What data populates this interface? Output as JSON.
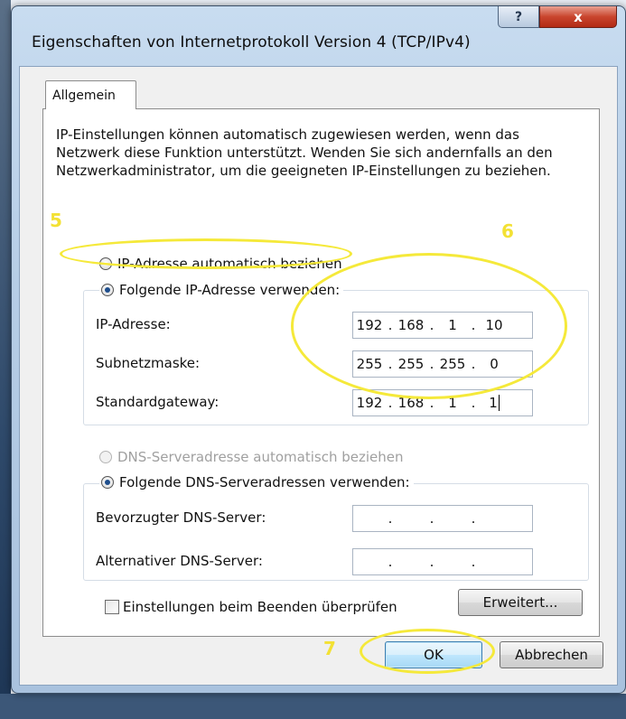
{
  "dialog": {
    "title": "Eigenschaften von Internetprotokoll Version 4 (TCP/IPv4)",
    "help_label": "?",
    "close_label": "x"
  },
  "tab": {
    "label": "Allgemein"
  },
  "description": "IP-Einstellungen können automatisch zugewiesen werden, wenn das Netzwerk diese Funktion unterstützt. Wenden Sie sich andernfalls an den Netzwerkadministrator, um die geeigneten IP-Einstellungen zu beziehen.",
  "ip_section": {
    "auto_label": "IP-Adresse automatisch beziehen",
    "manual_label": "Folgende IP-Adresse verwenden:",
    "selected": "manual",
    "fields": [
      {
        "label": "IP-Adresse:",
        "octets": [
          "192",
          "168",
          "1",
          "10"
        ]
      },
      {
        "label": "Subnetzmaske:",
        "octets": [
          "255",
          "255",
          "255",
          "0"
        ]
      },
      {
        "label": "Standardgateway:",
        "octets": [
          "192",
          "168",
          "1",
          "1"
        ]
      }
    ]
  },
  "dns_section": {
    "auto_label": "DNS-Serveradresse automatisch beziehen",
    "manual_label": "Folgende DNS-Serveradressen verwenden:",
    "selected": "manual",
    "fields": [
      {
        "label": "Bevorzugter DNS-Server:",
        "octets": [
          "",
          "",
          "",
          ""
        ]
      },
      {
        "label": "Alternativer DNS-Server:",
        "octets": [
          "",
          "",
          "",
          ""
        ]
      }
    ]
  },
  "validate_checkbox": {
    "label": "Einstellungen beim Beenden überprüfen",
    "checked": false
  },
  "buttons": {
    "advanced": "Erweitert...",
    "ok": "OK",
    "cancel": "Abbrechen"
  },
  "annotations": {
    "step5": "5",
    "step6": "6",
    "step7": "7",
    "highlight_color": "#f5e93a"
  },
  "colors": {
    "close_button": "#c9452e",
    "window_frame": "#b6cde6",
    "default_button_border": "#3c7fb1"
  }
}
